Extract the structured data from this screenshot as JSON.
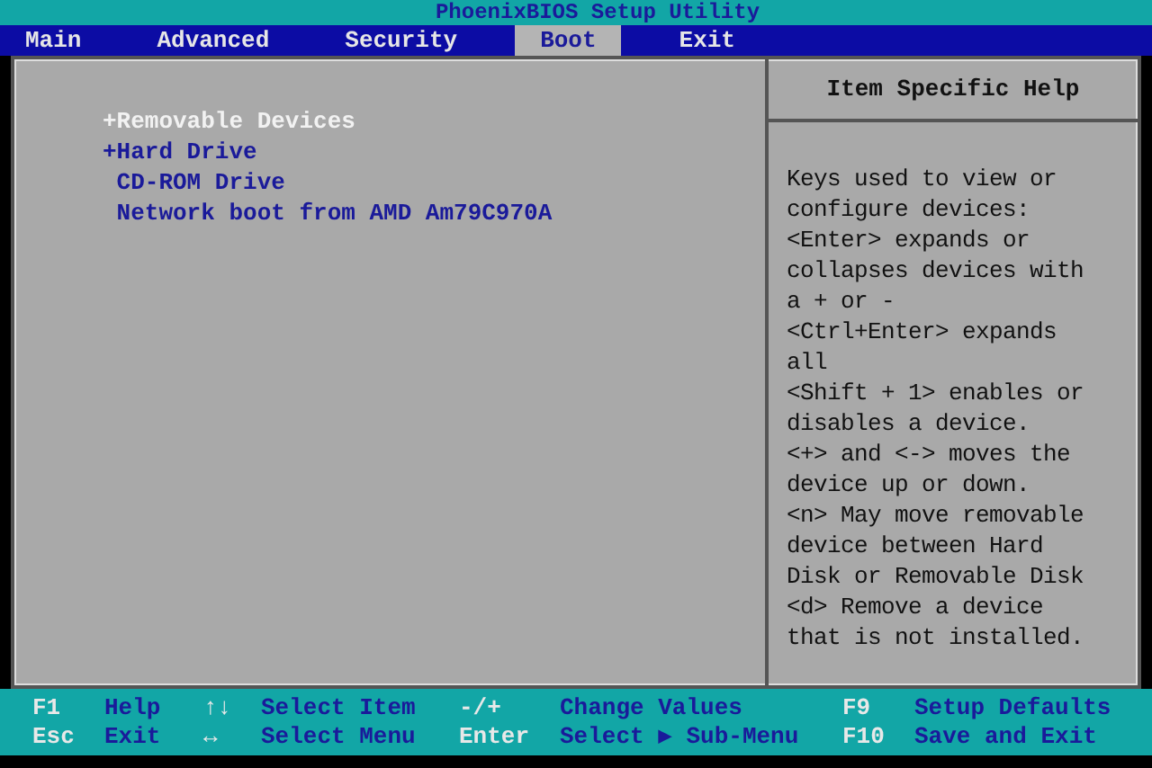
{
  "window": {
    "title": "PhoenixBIOS Setup Utility"
  },
  "tabs": [
    {
      "label": "Main",
      "selected": false
    },
    {
      "label": "Advanced",
      "selected": false
    },
    {
      "label": "Security",
      "selected": false
    },
    {
      "label": "Boot",
      "selected": true
    },
    {
      "label": "Exit",
      "selected": false
    }
  ],
  "boot_items": [
    {
      "label": "+Removable Devices",
      "selected": true
    },
    {
      "label": "+Hard Drive",
      "selected": false
    },
    {
      "label": " CD-ROM Drive",
      "selected": false
    },
    {
      "label": " Network boot from AMD Am79C970A",
      "selected": false
    }
  ],
  "help": {
    "title": "Item Specific Help",
    "lines": [
      "Keys used to view or",
      "configure devices:",
      "<Enter> expands or",
      "collapses devices with",
      "a + or -",
      "<Ctrl+Enter> expands",
      "all",
      "<Shift + 1> enables or",
      "disables a device.",
      "<+> and <-> moves the",
      "device up or down.",
      "<n> May move removable",
      "device between Hard",
      "Disk or Removable Disk",
      "<d> Remove a device",
      "that is not installed."
    ]
  },
  "status_bar": [
    [
      {
        "key": "F1",
        "action": "Help"
      },
      {
        "key": "↑↓",
        "action": "Select Item"
      },
      {
        "key": "-/+",
        "action": "Change Values"
      },
      {
        "key": "F9",
        "action": "Setup Defaults"
      }
    ],
    [
      {
        "key": "Esc",
        "action": "Exit"
      },
      {
        "key": "↔",
        "action": "Select Menu"
      },
      {
        "key": "Enter",
        "action": "Select ▶ Sub-Menu"
      },
      {
        "key": "F10",
        "action": "Save and Exit"
      }
    ]
  ]
}
